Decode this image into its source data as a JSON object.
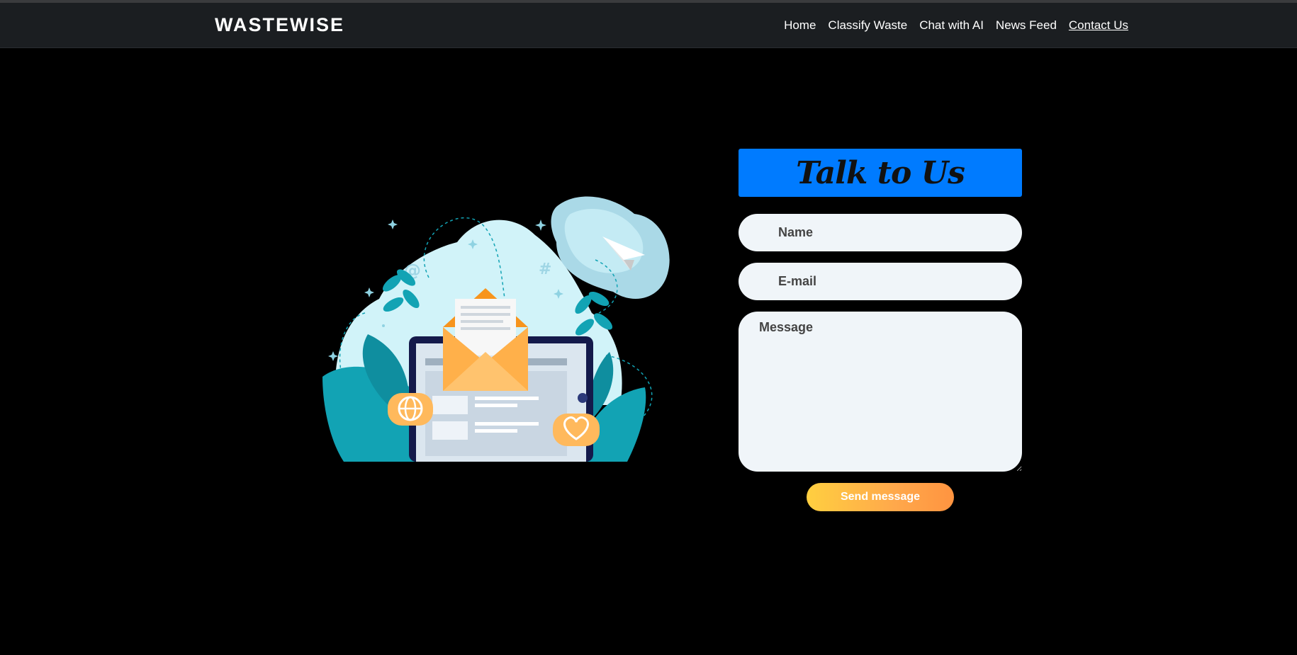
{
  "navbar": {
    "brand": "WASTEWISE",
    "links": [
      {
        "label": "Home"
      },
      {
        "label": "Classify Waste"
      },
      {
        "label": "Chat with AI"
      },
      {
        "label": "News Feed"
      },
      {
        "label": "Contact Us",
        "active": true
      }
    ]
  },
  "illustration": {
    "icon": "envelope-tablet-illustration",
    "at_symbol": "@",
    "hash_symbol": "#"
  },
  "contact_form": {
    "title": "Talk to Us",
    "name_placeholder": "Name",
    "email_placeholder": "E-mail",
    "message_placeholder": "Message",
    "submit_label": "Send message"
  },
  "colors": {
    "background": "#000000",
    "navbar": "#1b1e21",
    "title_bg": "#007bff",
    "field_bg": "#f0f5f9",
    "button_gradient": [
      "#ffcf40",
      "#ff9440"
    ],
    "teal": "#12a3b4",
    "orange": "#ffb04a"
  }
}
